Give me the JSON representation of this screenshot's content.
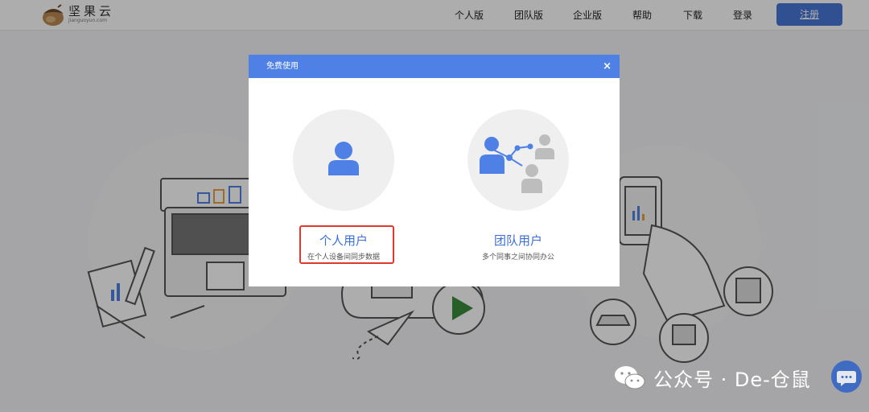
{
  "header": {
    "logo_name": "坚果云",
    "logo_sub": "jianguoyun.com",
    "nav": [
      {
        "label": "个人版"
      },
      {
        "label": "团队版"
      },
      {
        "label": "企业版"
      },
      {
        "label": "帮助"
      },
      {
        "label": "下载"
      },
      {
        "label": "登录"
      }
    ],
    "register_label": "注册"
  },
  "modal": {
    "title": "免费使用",
    "close_glyph": "×",
    "options": [
      {
        "title": "个人用户",
        "subtitle": "在个人设备间同步数据",
        "icon": "single-user-icon",
        "highlighted": true
      },
      {
        "title": "团队用户",
        "subtitle": "多个同事之间协同办公",
        "icon": "team-network-icon",
        "highlighted": false
      }
    ]
  },
  "watermark": {
    "text": "公众号 · De-仓鼠",
    "icon": "wechat-icon"
  },
  "colors": {
    "accent": "#4f80e6",
    "register": "#4877d8",
    "highlight": "#e0392b",
    "option_title": "#3b6fd6"
  }
}
